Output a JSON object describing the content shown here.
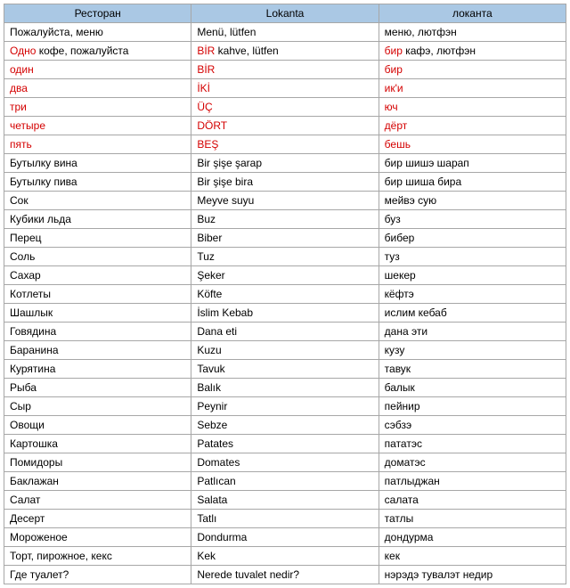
{
  "headers": [
    "Ресторан",
    "Lokanta",
    "локанта"
  ],
  "rows": [
    {
      "c": [
        {
          "t": "  Пожалуйста, меню",
          "cls": ""
        },
        {
          "t": "Menü, lütfen",
          "cls": ""
        },
        {
          "t": "меню, лютфэн",
          "cls": ""
        }
      ]
    },
    {
      "c": [
        {
          "parts": [
            {
              "t": "Одно",
              "cls": "red"
            },
            {
              "t": " кофе, пожалуйста",
              "cls": "black"
            }
          ]
        },
        {
          "parts": [
            {
              "t": "BİR",
              "cls": "red"
            },
            {
              "t": " kahve, lütfen",
              "cls": "black"
            }
          ]
        },
        {
          "parts": [
            {
              "t": "бир",
              "cls": "red"
            },
            {
              "t": " кафэ, лютфэн",
              "cls": "black"
            }
          ]
        }
      ]
    },
    {
      "c": [
        {
          "t": "один",
          "cls": "red"
        },
        {
          "t": "BİR",
          "cls": "red"
        },
        {
          "t": "бир",
          "cls": "red"
        }
      ]
    },
    {
      "c": [
        {
          "t": "два",
          "cls": "red"
        },
        {
          "t": "İKİ",
          "cls": "red"
        },
        {
          "t": "ик'и",
          "cls": "red"
        }
      ]
    },
    {
      "c": [
        {
          "t": "три",
          "cls": "red"
        },
        {
          "t": "ÜÇ",
          "cls": "red"
        },
        {
          "t": "юч",
          "cls": "red"
        }
      ]
    },
    {
      "c": [
        {
          "t": "четыре",
          "cls": "red"
        },
        {
          "t": "DÖRT",
          "cls": "red"
        },
        {
          "t": "дёрт",
          "cls": "red"
        }
      ]
    },
    {
      "c": [
        {
          "t": "пять",
          "cls": "red"
        },
        {
          "t": "BEŞ",
          "cls": "red"
        },
        {
          "t": "бешь",
          "cls": "red"
        }
      ]
    },
    {
      "c": [
        {
          "t": "Бутылку вина",
          "cls": ""
        },
        {
          "t": "Bir şişe şarap",
          "cls": ""
        },
        {
          "t": "бир шишэ шарап",
          "cls": ""
        }
      ]
    },
    {
      "c": [
        {
          "t": "Бутылку пива",
          "cls": ""
        },
        {
          "t": "Bir şişe bira",
          "cls": ""
        },
        {
          "t": "бир шиша бира",
          "cls": ""
        }
      ]
    },
    {
      "c": [
        {
          "t": "Сок",
          "cls": ""
        },
        {
          "t": "Meyve suyu",
          "cls": ""
        },
        {
          "t": "мейвэ сую",
          "cls": ""
        }
      ]
    },
    {
      "c": [
        {
          "t": "Кубики льда",
          "cls": ""
        },
        {
          "t": "Buz",
          "cls": ""
        },
        {
          "t": "буз",
          "cls": ""
        }
      ]
    },
    {
      "c": [
        {
          "t": "Перец",
          "cls": ""
        },
        {
          "t": "Biber",
          "cls": ""
        },
        {
          "t": "бибер",
          "cls": ""
        }
      ]
    },
    {
      "c": [
        {
          "t": "Соль",
          "cls": ""
        },
        {
          "t": "Tuz",
          "cls": ""
        },
        {
          "t": "туз",
          "cls": ""
        }
      ]
    },
    {
      "c": [
        {
          "t": "Сахар",
          "cls": ""
        },
        {
          "t": "Şeker",
          "cls": ""
        },
        {
          "t": "шекер",
          "cls": ""
        }
      ]
    },
    {
      "c": [
        {
          "t": "Котлеты",
          "cls": ""
        },
        {
          "t": "Köfte",
          "cls": ""
        },
        {
          "t": "кёфтэ",
          "cls": ""
        }
      ]
    },
    {
      "c": [
        {
          "t": "Шашлык",
          "cls": ""
        },
        {
          "t": "İslim Kebab",
          "cls": ""
        },
        {
          "t": "ислим кебаб",
          "cls": ""
        }
      ]
    },
    {
      "c": [
        {
          "t": "Говядина",
          "cls": ""
        },
        {
          "t": "Dana eti",
          "cls": ""
        },
        {
          "t": "дана эти",
          "cls": ""
        }
      ]
    },
    {
      "c": [
        {
          "t": "Баранина",
          "cls": ""
        },
        {
          "t": "Kuzu",
          "cls": ""
        },
        {
          "t": "кузу",
          "cls": ""
        }
      ]
    },
    {
      "c": [
        {
          "t": "Курятина",
          "cls": ""
        },
        {
          "t": "Tavuk",
          "cls": ""
        },
        {
          "t": "тавук",
          "cls": ""
        }
      ]
    },
    {
      "c": [
        {
          "t": "Рыба",
          "cls": ""
        },
        {
          "t": "Balık",
          "cls": ""
        },
        {
          "t": "балык",
          "cls": ""
        }
      ]
    },
    {
      "c": [
        {
          "t": "Сыр",
          "cls": ""
        },
        {
          "t": "Peynir",
          "cls": ""
        },
        {
          "t": "пейнир",
          "cls": ""
        }
      ]
    },
    {
      "c": [
        {
          "t": "Овощи",
          "cls": ""
        },
        {
          "t": "Sebze",
          "cls": ""
        },
        {
          "t": "сэбзэ",
          "cls": ""
        }
      ]
    },
    {
      "c": [
        {
          "t": "Картошка",
          "cls": ""
        },
        {
          "t": "Patates",
          "cls": ""
        },
        {
          "t": "пататэс",
          "cls": ""
        }
      ]
    },
    {
      "c": [
        {
          "t": "Помидоры",
          "cls": ""
        },
        {
          "t": "Domates",
          "cls": ""
        },
        {
          "t": "доматэс",
          "cls": ""
        }
      ]
    },
    {
      "c": [
        {
          "t": "Баклажан",
          "cls": ""
        },
        {
          "t": "Patlıcan",
          "cls": ""
        },
        {
          "t": "патлыджан",
          "cls": ""
        }
      ]
    },
    {
      "c": [
        {
          "t": "Салат",
          "cls": ""
        },
        {
          "t": "Salata",
          "cls": ""
        },
        {
          "t": "салата",
          "cls": ""
        }
      ]
    },
    {
      "c": [
        {
          "t": "Десерт",
          "cls": ""
        },
        {
          "t": "Tatlı",
          "cls": ""
        },
        {
          "t": "татлы",
          "cls": ""
        }
      ]
    },
    {
      "c": [
        {
          "t": "Мороженое",
          "cls": ""
        },
        {
          "t": "Dondurma",
          "cls": ""
        },
        {
          "t": "дондурма",
          "cls": ""
        }
      ]
    },
    {
      "c": [
        {
          "t": "Торт, пирожное, кекс",
          "cls": ""
        },
        {
          "t": "Kek",
          "cls": ""
        },
        {
          "t": "кек",
          "cls": ""
        }
      ]
    },
    {
      "c": [
        {
          "t": "Где туалет?",
          "cls": ""
        },
        {
          "t": "Nerede tuvalet nedir?",
          "cls": ""
        },
        {
          "t": "нэрэдэ тувалэт недир",
          "cls": ""
        }
      ]
    }
  ]
}
